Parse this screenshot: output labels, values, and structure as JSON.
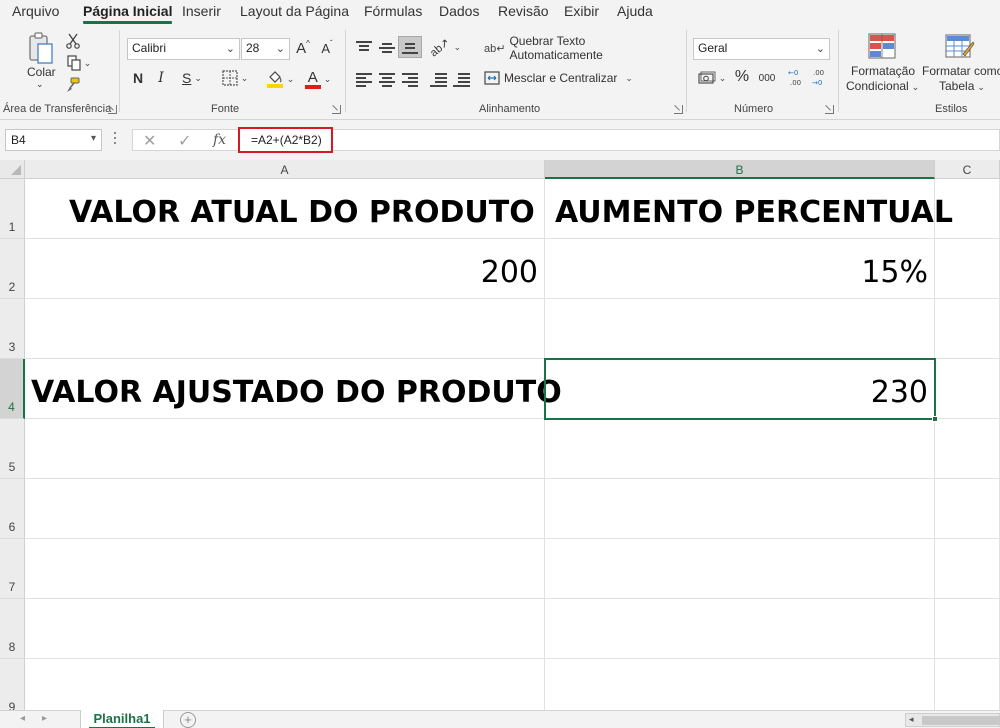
{
  "menu": {
    "tabs": [
      {
        "label": "Arquivo"
      },
      {
        "label": "Página Inicial",
        "active": true
      },
      {
        "label": "Inserir"
      },
      {
        "label": "Layout da Página"
      },
      {
        "label": "Fórmulas"
      },
      {
        "label": "Dados"
      },
      {
        "label": "Revisão"
      },
      {
        "label": "Exibir"
      },
      {
        "label": "Ajuda"
      }
    ]
  },
  "ribbon": {
    "clipboard": {
      "paste_label": "Colar",
      "group_label": "Área de Transferência"
    },
    "font": {
      "family": "Calibri",
      "size": "28",
      "bold": "N",
      "italic": "I",
      "underline": "S",
      "grow": "A",
      "shrink": "A",
      "color_letter": "A",
      "group_label": "Fonte"
    },
    "alignment": {
      "wrap_label": "Quebrar Texto Automaticamente",
      "merge_label": "Mesclar e Centralizar",
      "group_label": "Alinhamento"
    },
    "number": {
      "format": "Geral",
      "percent": "%",
      "thousands": "000",
      "group_label": "Número"
    },
    "styles": {
      "conditional_line1": "Formatação",
      "conditional_line2": "Condicional",
      "table_line1": "Formatar como",
      "table_line2": "Tabela",
      "group_label": "Estilos"
    }
  },
  "formula_bar": {
    "name_box": "B4",
    "cancel": "✕",
    "confirm": "✓",
    "fx": "fx",
    "formula": "=A2+(A2*B2)"
  },
  "sheet": {
    "columns": [
      "A",
      "B",
      "C"
    ],
    "rows": [
      "1",
      "2",
      "3",
      "4",
      "5",
      "6",
      "7",
      "8",
      "9"
    ],
    "cells": {
      "A1": "VALOR ATUAL DO PRODUTO",
      "B1": "AUMENTO PERCENTUAL",
      "A2": "200",
      "B2": "15%",
      "A4": "VALOR AJUSTADO DO PRODUTO",
      "B4": "230"
    },
    "active_cell": "B4"
  },
  "tabs": {
    "sheet_name": "Planilha1",
    "add_sheet": "+"
  },
  "colors": {
    "accent": "#1e7145",
    "highlight_border": "#d61a24",
    "fill_yellow": "#ffd400",
    "font_red": "#e01c1c"
  }
}
